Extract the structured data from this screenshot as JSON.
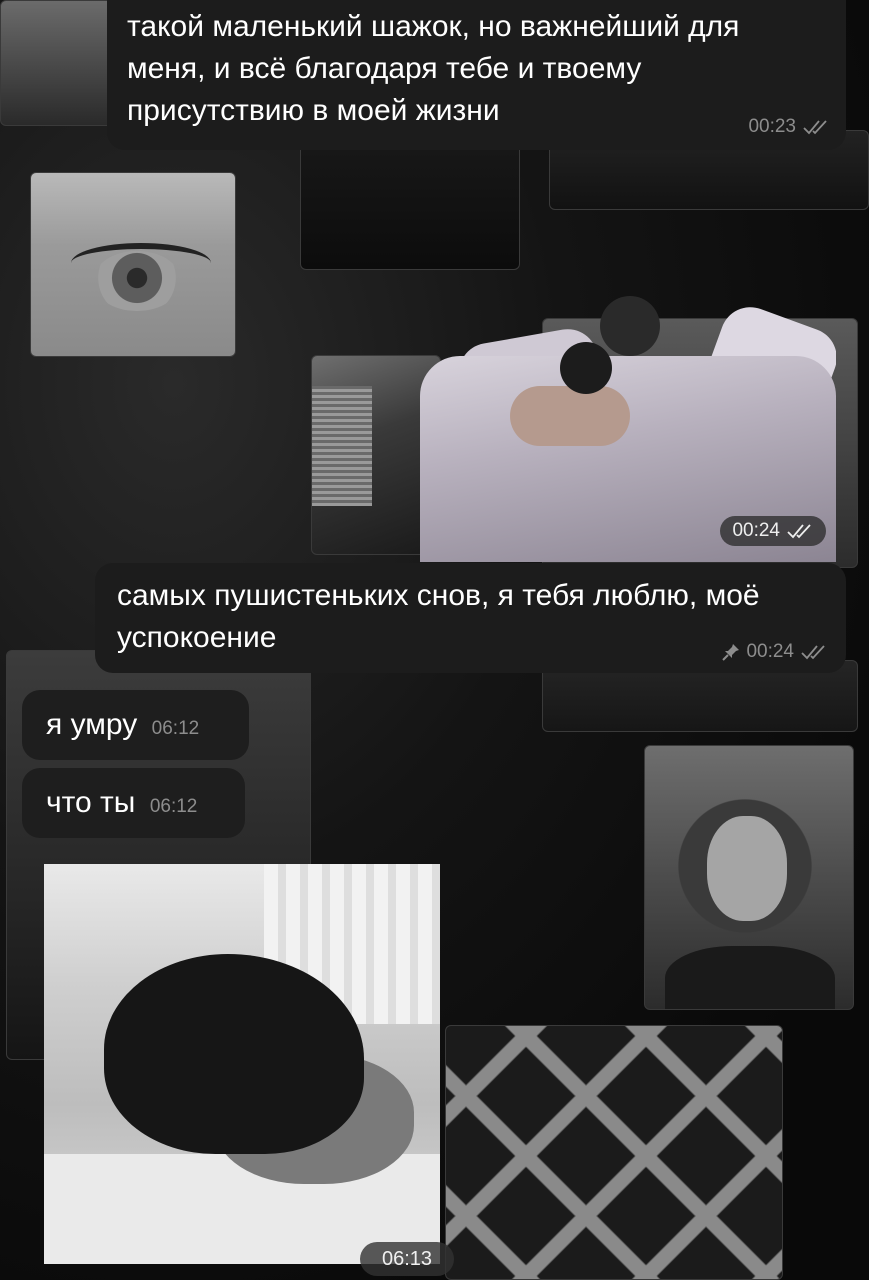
{
  "messages": [
    {
      "direction": "outgoing",
      "text": "такой маленький шажок, но важнейший для меня, и всё благодаря тебе и твоему присутствию в моей жизни",
      "time": "00:23",
      "status": "read"
    },
    {
      "direction": "outgoing",
      "type": "photo",
      "time": "00:24",
      "status": "read"
    },
    {
      "direction": "outgoing",
      "text": "самых пушистеньких снов, я тебя люблю, моё успокоение",
      "time": "00:24",
      "status": "read",
      "pinned": true
    },
    {
      "direction": "incoming",
      "text": "я умру",
      "time": "06:12"
    },
    {
      "direction": "incoming",
      "text": "что ты",
      "time": "06:12"
    },
    {
      "direction": "incoming",
      "type": "photo",
      "time": "06:13"
    }
  ],
  "icons": {
    "read": "double-check-icon",
    "pin": "pin-icon"
  },
  "colors": {
    "bubble": "#1e1e1e",
    "meta_text": "#8d8d8d",
    "background": "#0b0b0b"
  }
}
